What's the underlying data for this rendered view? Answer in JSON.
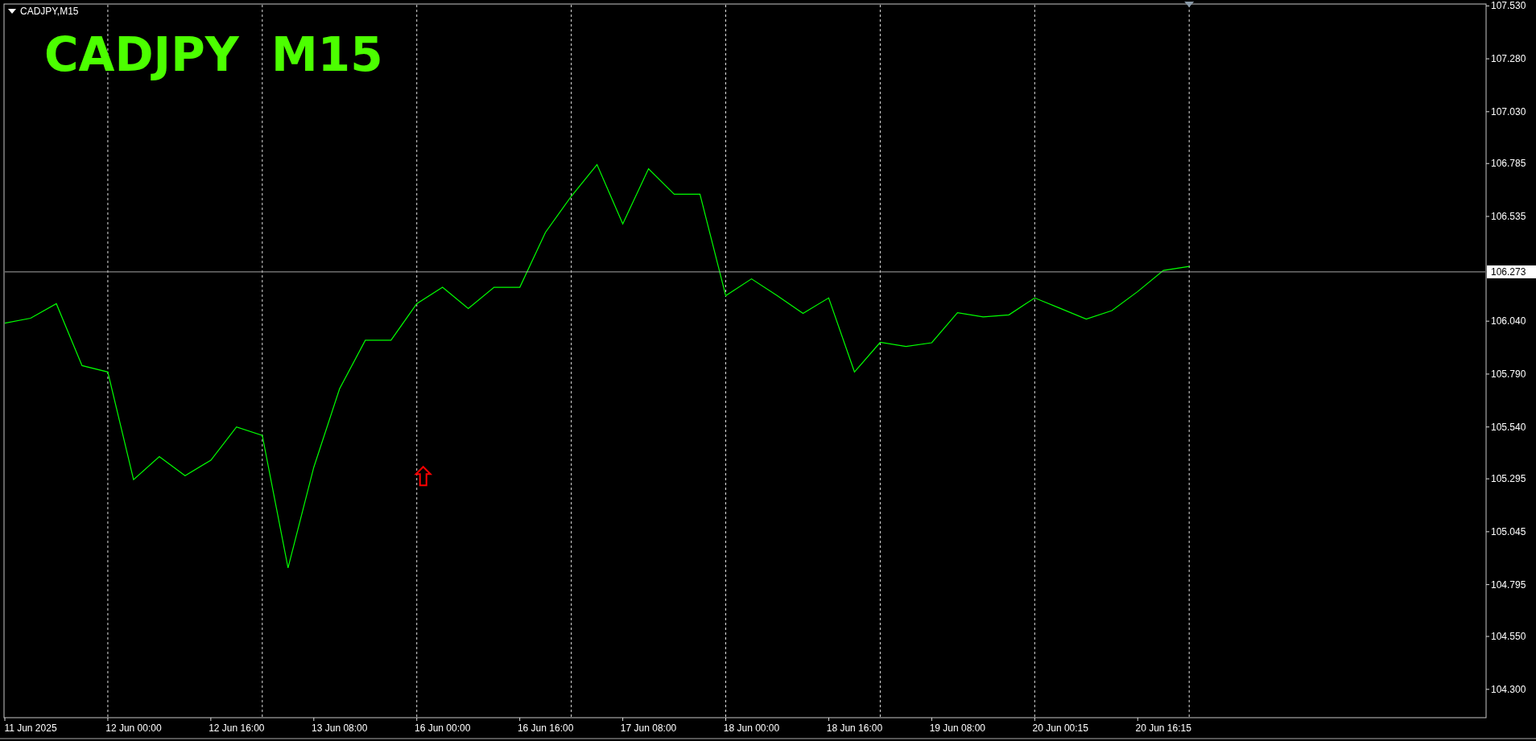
{
  "chart_window": {
    "caption": "CADJPY,M15",
    "title": "CADJPY  M15"
  },
  "chart_data": {
    "type": "line",
    "categories": [
      null,
      "11 Jun 2025",
      null,
      null,
      null,
      "12 Jun 00:00",
      null,
      null,
      null,
      "12 Jun 16:00",
      null,
      null,
      null,
      "13 Jun 08:00",
      null,
      null,
      null,
      "16 Jun 00:00",
      null,
      null,
      null,
      "16 Jun 16:00",
      null,
      null,
      null,
      "17 Jun 08:00",
      null,
      null,
      null,
      "18 Jun 00:00",
      null,
      null,
      null,
      "18 Jun 16:00",
      null,
      null,
      null,
      "19 Jun 08:00",
      null,
      null,
      null,
      "20 Jun 00:15",
      null,
      null,
      null,
      "20 Jun 16:15",
      null
    ],
    "grid": true,
    "series": [
      {
        "color": "#00ff00",
        "values": [
          106.031,
          106.054,
          106.123,
          105.83,
          105.8,
          105.291,
          105.4,
          105.31,
          105.383,
          105.54,
          105.5,
          104.874,
          105.35,
          105.72,
          105.95,
          105.95,
          106.123,
          106.2,
          106.1,
          106.2,
          106.2,
          106.46,
          106.63,
          106.78,
          106.5,
          106.76,
          106.64,
          106.64,
          106.16,
          106.24,
          106.16,
          106.077,
          106.15,
          105.8,
          105.94,
          105.92,
          105.938,
          106.08,
          106.06,
          106.07,
          106.15,
          106.1,
          106.05,
          106.09,
          106.18,
          106.28,
          106.299
        ]
      }
    ],
    "ylim": [
      104.17,
      107.535
    ],
    "yticks": [
      {
        "value": 107.53,
        "label": "107.530"
      },
      {
        "value": 107.28,
        "label": "107.280"
      },
      {
        "value": 107.03,
        "label": "107.030"
      },
      {
        "value": 106.785,
        "label": "106.785"
      },
      {
        "value": 106.535,
        "label": "106.535"
      },
      {
        "value": 106.04,
        "label": "106.040"
      },
      {
        "value": 105.79,
        "label": "105.790"
      },
      {
        "value": 105.54,
        "label": "105.540"
      },
      {
        "value": 105.295,
        "label": "105.295"
      },
      {
        "value": 105.045,
        "label": "105.045"
      },
      {
        "value": 104.795,
        "label": "104.795"
      },
      {
        "value": 104.55,
        "label": "104.550"
      },
      {
        "value": 104.3,
        "label": "104.300"
      }
    ],
    "ref_lines": [
      {
        "axis": "y",
        "value": 106.273,
        "label": "106.273"
      }
    ]
  }
}
